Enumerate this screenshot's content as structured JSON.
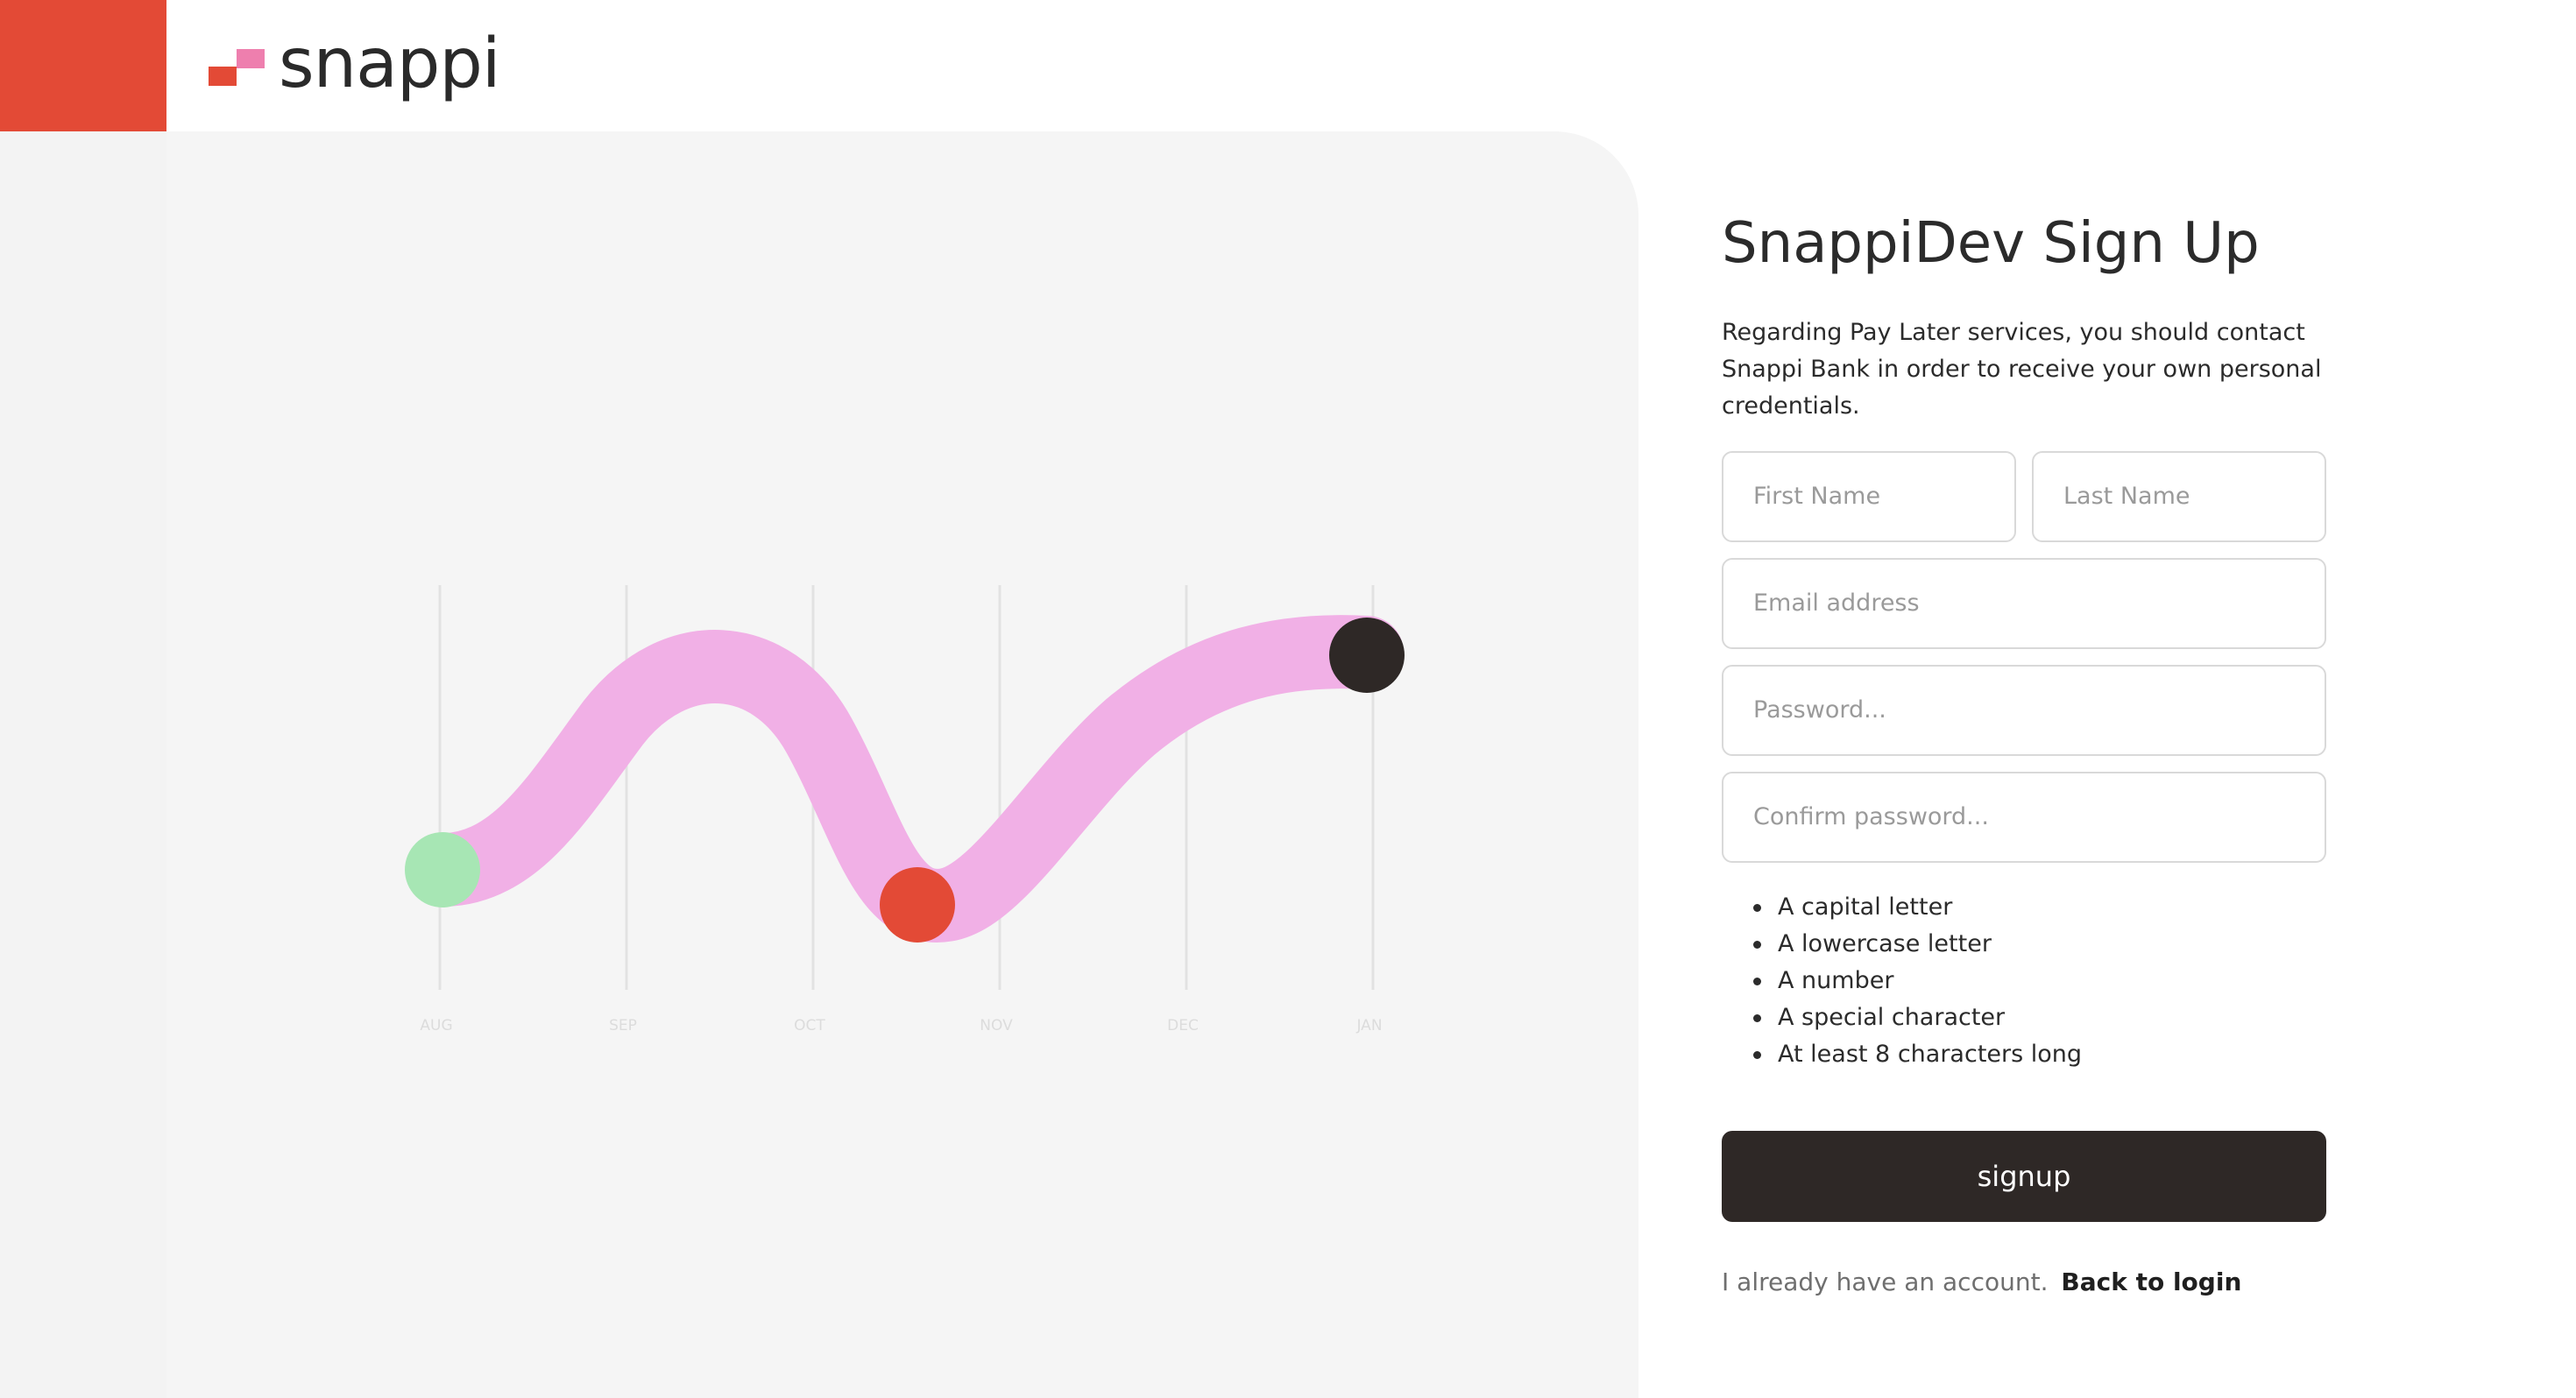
{
  "brand": {
    "name": "snappi",
    "colors": {
      "red": "#e34a36",
      "pink": "#ee7fae",
      "dark": "#2e2826",
      "green": "#a7e6b4",
      "wave": "#f1b0e6"
    }
  },
  "illustration": {
    "months": [
      "AUG",
      "SEP",
      "OCT",
      "NOV",
      "DEC",
      "JAN"
    ]
  },
  "form": {
    "title": "SnappiDev Sign Up",
    "description": "Regarding Pay Later services, you should contact Snappi Bank in order to receive your own personal credentials.",
    "first_name_placeholder": "First Name",
    "last_name_placeholder": "Last Name",
    "email_placeholder": "Email address",
    "password_placeholder": "Password...",
    "confirm_password_placeholder": "Confirm password...",
    "password_rules": [
      "A capital letter",
      "A lowercase letter",
      "A number",
      "A special character",
      "At least 8 characters long"
    ],
    "signup_label": "signup",
    "login_prompt": "I already have an account.",
    "login_link": "Back to login"
  }
}
